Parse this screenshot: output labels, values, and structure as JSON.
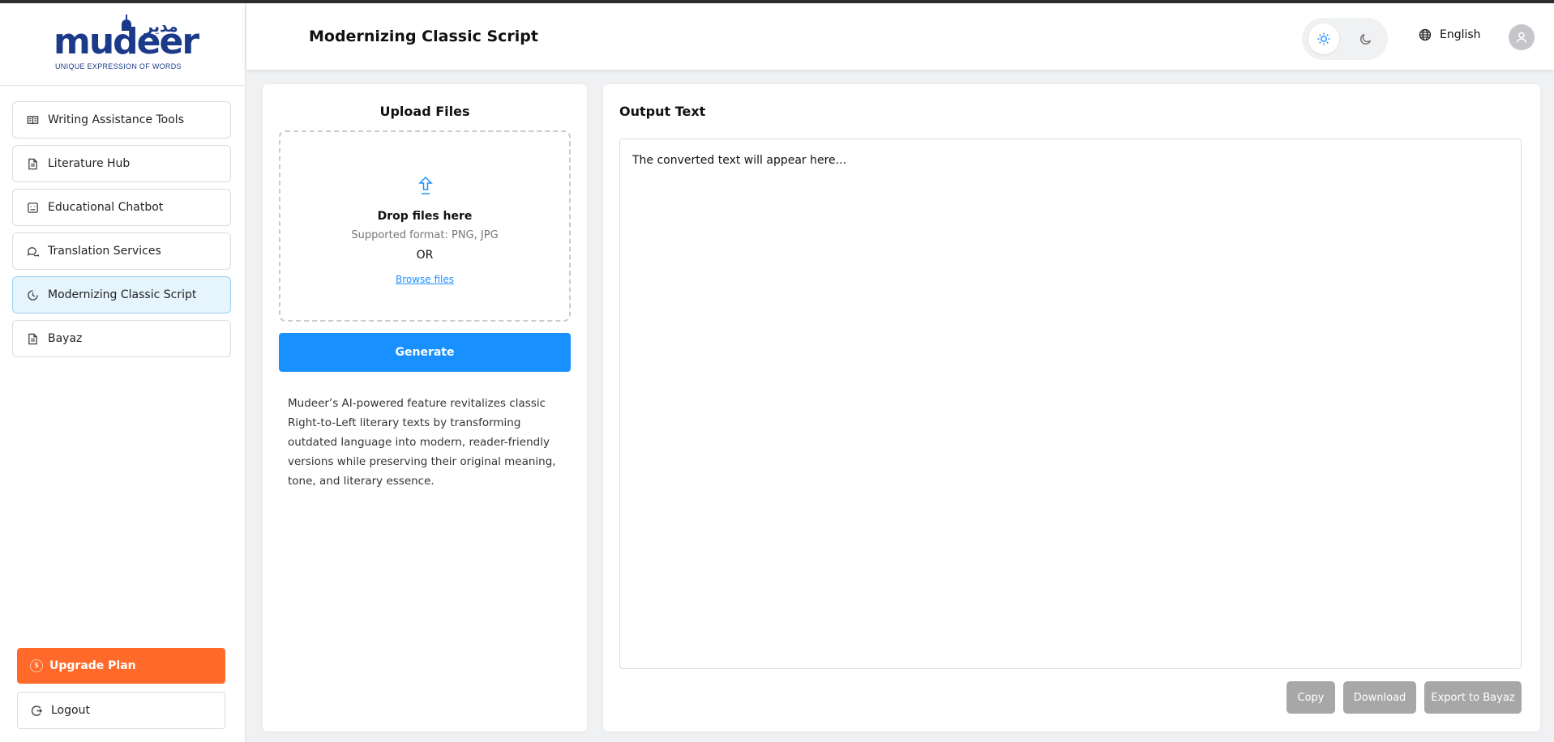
{
  "app": {
    "logo_arabic": "مدير",
    "logo_text": "mudeer",
    "logo_tagline": "UNIQUE EXPRESSION OF WORDS"
  },
  "header": {
    "title": "Modernizing Classic Script",
    "language": "English"
  },
  "sidebar": {
    "items": [
      {
        "label": "Writing Assistance Tools",
        "icon": "book-icon"
      },
      {
        "label": "Literature Hub",
        "icon": "document-icon"
      },
      {
        "label": "Educational Chatbot",
        "icon": "bot-icon"
      },
      {
        "label": "Translation Services",
        "icon": "chat-bubbles-icon"
      },
      {
        "label": "Modernizing Classic Script",
        "icon": "clock-icon",
        "active": true
      },
      {
        "label": "Bayaz",
        "icon": "document-icon"
      }
    ],
    "upgrade_label": "Upgrade Plan",
    "logout_label": "Logout"
  },
  "upload": {
    "title": "Upload Files",
    "drop_title": "Drop files here",
    "format": "Supported format: PNG, JPG",
    "or": "OR",
    "browse": "Browse files",
    "generate": "Generate",
    "description": "Mudeer’s AI-powered feature revitalizes classic Right-to-Left literary texts by transforming outdated language into modern, reader-friendly versions while preserving their original meaning, tone, and literary essence."
  },
  "output": {
    "title": "Output Text",
    "placeholder": "The converted text will appear here...",
    "copy": "Copy",
    "download": "Download",
    "export": "Export to Bayaz"
  },
  "colors": {
    "accent": "#1890ff",
    "upgrade": "#ff6a2b",
    "active_bg": "#e6f4fd",
    "disabled_btn": "#a7a7a7"
  }
}
